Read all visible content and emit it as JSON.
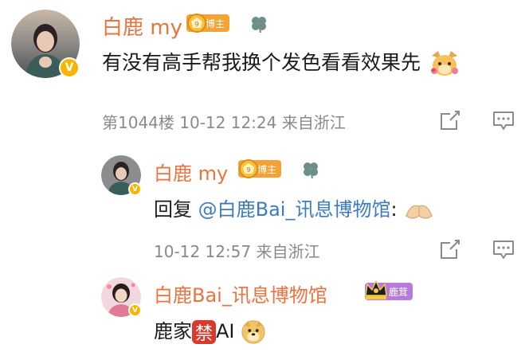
{
  "comment": {
    "user": {
      "name": "白鹿 my",
      "role_badge": "博主"
    },
    "text": "有没有高手帮我换个发色看看效果先",
    "meta": "第1044楼  10-12 12:24  来自浙江"
  },
  "replies": [
    {
      "user": {
        "name": "白鹿 my",
        "role_badge": "博主"
      },
      "prefix": "回复 ",
      "mention": "@白鹿Bai_讯息博物馆",
      "suffix": ":",
      "meta": "10-12 12:57  来自浙江"
    },
    {
      "user": {
        "name": "白鹿Bai_讯息博物馆",
        "fan_badge": "鹿茸"
      },
      "text_before": "鹿家",
      "ban_char": "禁",
      "text_after": "AI"
    }
  ],
  "icons": [
    "verified-badge-icon",
    "clover-icon",
    "dog-face-emoji-icon",
    "hands-emoji-icon",
    "share-icon",
    "comment-icon",
    "crown-icon",
    "medal-icon"
  ],
  "colors": {
    "username": "#eb7340",
    "mention": "#3d7bbf",
    "meta": "#8a8a8a",
    "role_badge": "#f5a234",
    "fan_badge": "#b77be0",
    "verified": "#f7b500"
  }
}
